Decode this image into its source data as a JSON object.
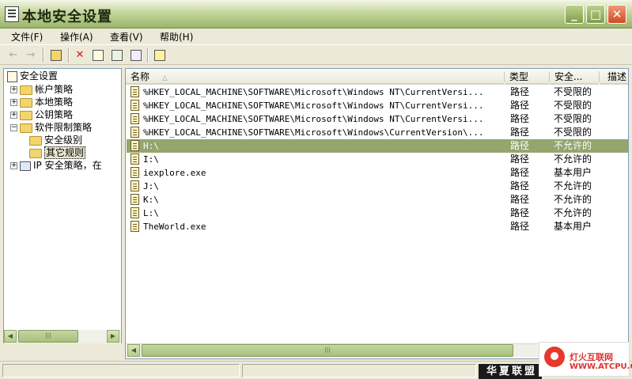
{
  "window": {
    "title": "本地安全设置",
    "min_glyph": "_",
    "max_glyph": "□",
    "close_glyph": "✕"
  },
  "menu": [
    "文件(F)",
    "操作(A)",
    "查看(V)",
    "帮助(H)"
  ],
  "tree": {
    "root": "安全设置",
    "nodes": [
      "帐户策略",
      "本地策略",
      "公钥策略",
      "软件限制策略",
      "安全级别",
      "其它规则",
      "IP 安全策略，在"
    ]
  },
  "columns": {
    "name": "名称",
    "sort_glyph": "△",
    "type": "类型",
    "level": "安全...",
    "desc": "描述"
  },
  "rows": [
    {
      "name": "%HKEY_LOCAL_MACHINE\\SOFTWARE\\Microsoft\\Windows NT\\CurrentVersi...",
      "type": "路径",
      "level": "不受限的"
    },
    {
      "name": "%HKEY_LOCAL_MACHINE\\SOFTWARE\\Microsoft\\Windows NT\\CurrentVersi...",
      "type": "路径",
      "level": "不受限的"
    },
    {
      "name": "%HKEY_LOCAL_MACHINE\\SOFTWARE\\Microsoft\\Windows NT\\CurrentVersi...",
      "type": "路径",
      "level": "不受限的"
    },
    {
      "name": "%HKEY_LOCAL_MACHINE\\SOFTWARE\\Microsoft\\Windows\\CurrentVersion\\...",
      "type": "路径",
      "level": "不受限的"
    },
    {
      "name": "H:\\",
      "type": "路径",
      "level": "不允许的"
    },
    {
      "name": "I:\\",
      "type": "路径",
      "level": "不允许的"
    },
    {
      "name": "iexplore.exe",
      "type": "路径",
      "level": "基本用户"
    },
    {
      "name": "J:\\",
      "type": "路径",
      "level": "不允许的"
    },
    {
      "name": "K:\\",
      "type": "路径",
      "level": "不允许的"
    },
    {
      "name": "L:\\",
      "type": "路径",
      "level": "不允许的"
    },
    {
      "name": "TheWorld.exe",
      "type": "路径",
      "level": "基本用户"
    }
  ],
  "selected_row_index": 4,
  "watermark": {
    "left_text": "华夏联盟",
    "right_line1": "灯火互联网",
    "right_line2": "WWW.ATCPU.COM"
  },
  "colors": {
    "selected_row": "#94a56e",
    "title_gradient_end": "#9ab56b",
    "close_button": "#d14a22"
  }
}
